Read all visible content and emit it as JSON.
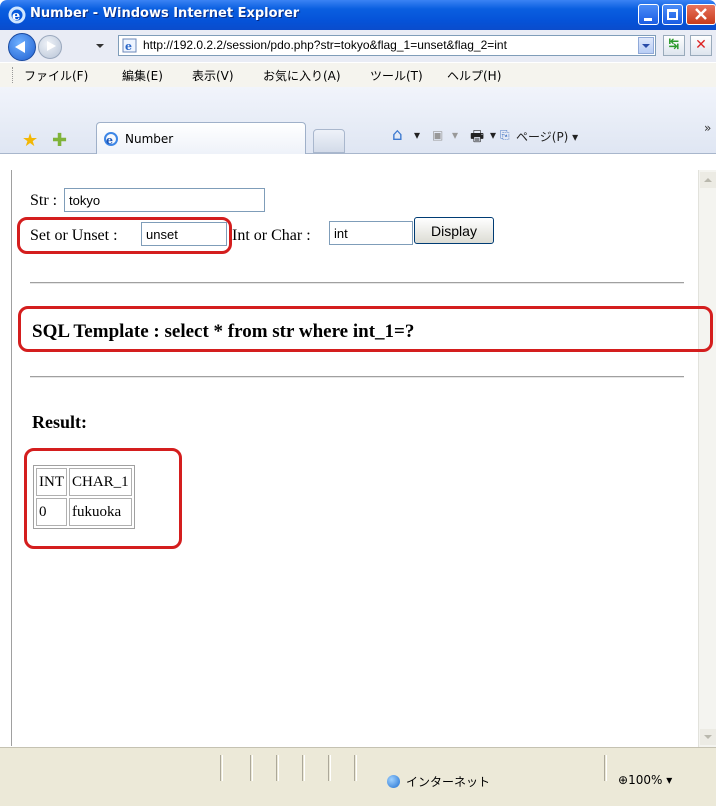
{
  "window": {
    "title": "Number - Windows Internet Explorer"
  },
  "address": {
    "url": "http://192.0.2.2/session/pdo.php?str=tokyo&flag_1=unset&flag_2=int"
  },
  "menu": [
    "ファイル(F)",
    "編集(E)",
    "表示(V)",
    "お気に入り(A)",
    "ツール(T)",
    "ヘルプ(H)"
  ],
  "tab": {
    "label": "Number"
  },
  "commands": {
    "page_label": "ページ(P) ▾"
  },
  "form": {
    "str_label": "Str :",
    "str_value": "tokyo",
    "set_label": "Set or Unset :",
    "set_value": "unset",
    "int_label": "Int or Char :",
    "int_value": "int",
    "display_button": "Display"
  },
  "sql_template": "SQL Template : select * from str where int_1=?",
  "result": {
    "heading": "Result:",
    "columns": [
      "INT",
      "CHAR_1"
    ],
    "rows": [
      [
        "0",
        "fukuoka"
      ]
    ]
  },
  "status": {
    "zone": "インターネット",
    "zoom": "100%"
  },
  "colors": {
    "titlebar": "#0552d8",
    "annotation_red": "#d41e1e"
  }
}
